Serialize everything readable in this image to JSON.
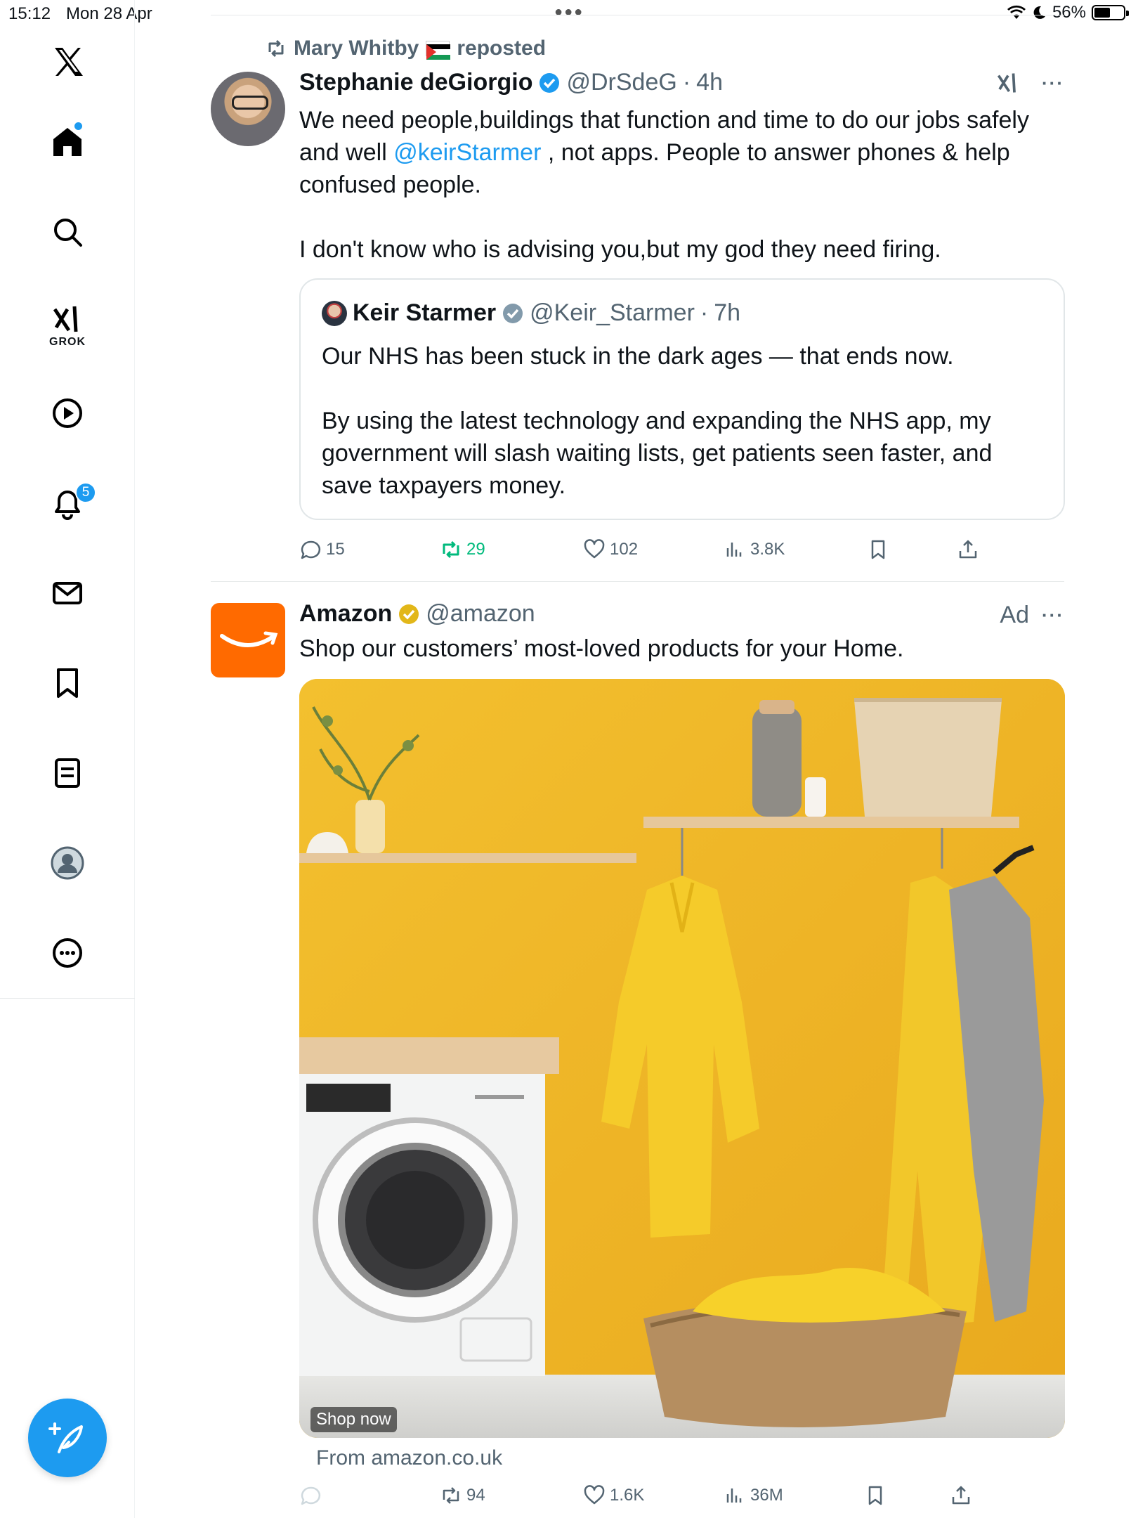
{
  "status_bar": {
    "time": "15:12",
    "date": "Mon 28 Apr",
    "battery": "56%",
    "battery_level": 0.56
  },
  "sidebar": {
    "items": [
      {
        "name": "x-logo"
      },
      {
        "name": "home",
        "has_dot": true
      },
      {
        "name": "search"
      },
      {
        "name": "grok",
        "label": "GROK"
      },
      {
        "name": "video"
      },
      {
        "name": "notifications",
        "badge": "5"
      },
      {
        "name": "messages"
      },
      {
        "name": "bookmarks"
      },
      {
        "name": "lists"
      },
      {
        "name": "profile"
      },
      {
        "name": "more"
      }
    ]
  },
  "post1": {
    "repost_by": "Mary Whitby",
    "repost_label": "reposted",
    "author": {
      "name": "Stephanie deGiorgio",
      "handle": "@DrSdeG",
      "time": "4h"
    },
    "text_p1_a": "We need people,buildings that function and time to do our jobs safely and well ",
    "text_mention": "@keirStarmer",
    "text_p1_b": " , not apps. People to answer phones & help confused people.",
    "text_p2": "I don't know who is advising you,but my god they need firing.",
    "quote": {
      "author": "Keir Starmer",
      "handle": "@Keir_Starmer",
      "time": "7h",
      "p1": "Our NHS has been stuck in the dark ages — that ends now.",
      "p2": "By using the latest technology and expanding the NHS app, my government will slash waiting lists, get patients seen faster, and save taxpayers money."
    },
    "stats": {
      "replies": "15",
      "reposts": "29",
      "likes": "102",
      "views": "3.8K"
    }
  },
  "post2": {
    "author": {
      "name": "Amazon",
      "handle": "@amazon"
    },
    "ad_label": "Ad",
    "text": "Shop our customers’ most-loved products for your Home.",
    "cta": "Shop now",
    "from": "From amazon.co.uk",
    "stats": {
      "reposts": "94",
      "likes": "1.6K",
      "views": "36M"
    }
  },
  "colors": {
    "accent": "#1d9bf0",
    "repost_green": "#00ba7c",
    "amazon_orange": "#ff6a00"
  }
}
